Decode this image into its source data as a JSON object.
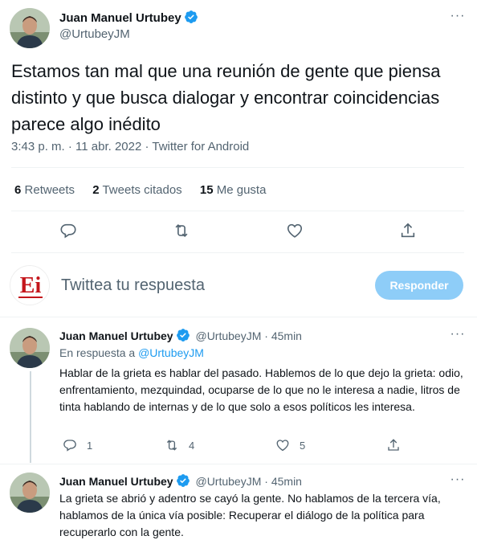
{
  "main_tweet": {
    "author_name": "Juan Manuel Urtubey",
    "author_handle": "@UrtubeyJM",
    "text": "Estamos tan mal que una reunión de gente que piensa distinto y que busca dialogar y encontrar coincidencias parece algo inédito",
    "meta": "3:43 p. m. · 11 abr. 2022 · Twitter for Android",
    "stats": {
      "retweets_count": "6",
      "retweets_label": "Retweets",
      "quotes_count": "2",
      "quotes_label": "Tweets citados",
      "likes_count": "15",
      "likes_label": "Me gusta"
    },
    "actions": [
      "reply-icon",
      "retweet-icon",
      "like-icon",
      "share-icon"
    ]
  },
  "composer": {
    "avatar_text": "Ei",
    "placeholder": "Twittea tu respuesta",
    "button_label": "Responder"
  },
  "replies": [
    {
      "author_name": "Juan Manuel Urtubey",
      "author_handle": "@UrtubeyJM",
      "time": "· 45min",
      "in_reply_prefix": "En respuesta a",
      "in_reply_handle": "@UrtubeyJM",
      "text": "Hablar de la grieta es hablar del pasado. Hablemos de lo que dejo la grieta: odio, enfrentamiento, mezquindad, ocuparse de lo que no le interesa a nadie, litros de tinta hablando de internas y de lo que solo a esos políticos les interesa.",
      "reply_count": "1",
      "retweet_count": "4",
      "like_count": "5"
    },
    {
      "author_name": "Juan Manuel Urtubey",
      "author_handle": "@UrtubeyJM",
      "time": "· 45min",
      "text": "La grieta se abrió y adentro se cayó la gente. No hablamos de la tercera vía, hablamos de la única vía posible: Recuperar el diálogo de la política para recuperarlo con la gente."
    }
  ],
  "colors": {
    "accent": "#1d9bf0",
    "button_disabled": "#8ecdf8",
    "secondary_text": "#536471",
    "brand_red": "#c4161c"
  }
}
